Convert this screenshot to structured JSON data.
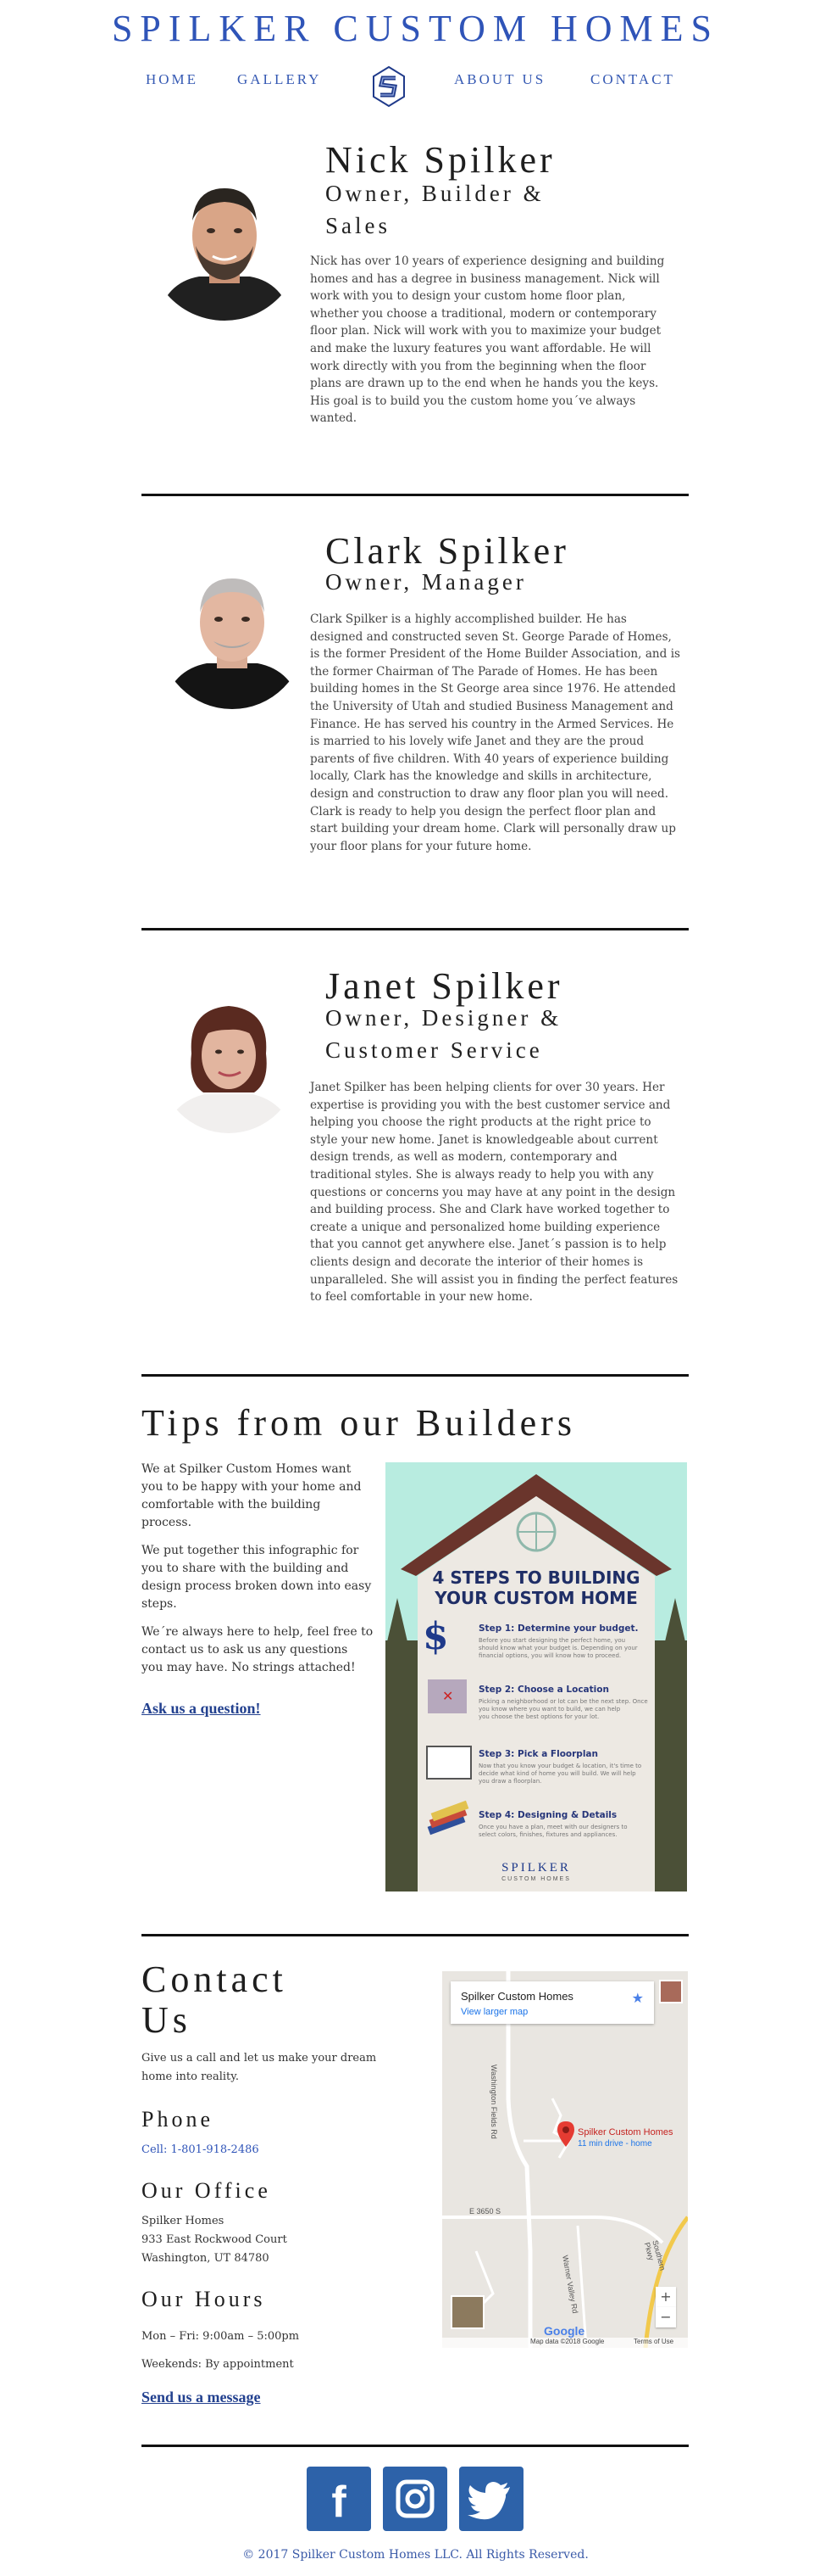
{
  "site": {
    "title": "SPILKER CUSTOM HOMES"
  },
  "nav": {
    "home": "HOME",
    "gallery": "GALLERY",
    "about": "ABOUT US",
    "contact": "CONTACT"
  },
  "team": [
    {
      "name": "Nick Spilker",
      "role_lines": [
        "Owner, Builder &",
        "Sales"
      ],
      "bio_lines": [
        "Nick has over 10 years of experience designing and building",
        "homes and has a degree in business management. Nick will",
        "work with you to design your custom home floor plan,",
        "whether you choose a traditional, modern or contemporary",
        "floor plan. Nick will work with you to maximize your budget",
        "and make the luxury features you want affordable. He will",
        "work directly with you from the beginning when the floor",
        "plans are drawn up to the end when he hands you the keys.",
        "His goal is to build you the custom home you´ve always",
        "wanted."
      ]
    },
    {
      "name": "Clark Spilker",
      "role_lines": [
        "Owner, Manager"
      ],
      "bio_lines": [
        "Clark Spilker is a highly accomplished builder. He has",
        "designed and constructed seven St. George Parade of Homes,",
        "is the former President of the Home Builder Association, and is",
        "the former Chairman of The Parade of Homes. He has been",
        "building homes in the St George area since 1976. He attended",
        "the University of Utah and studied Business Management and",
        "Finance. He has served his country in the Armed Services. He",
        "is married to his lovely wife Janet and they are the proud",
        "parents of five children. With 40 years of experience building",
        "locally, Clark has the knowledge and skills in architecture,",
        "design and construction to draw any floor plan you will need.",
        "Clark is ready to help you design the perfect floor plan and",
        "start building your dream home. Clark will personally draw up",
        "your floor plans for your future home."
      ]
    },
    {
      "name": "Janet Spilker",
      "role_lines": [
        "Owner, Designer &",
        "Customer Service"
      ],
      "bio_lines": [
        "Janet Spilker has been helping clients for over 30 years. Her",
        "expertise is providing you with the best customer service and",
        "helping you choose the right products at the right price to",
        "style your new home. Janet is knowledgeable about current",
        "design trends, as well as modern, contemporary and",
        "traditional styles. She is always ready to help you with any",
        "questions or concerns you may have at any point in the design",
        "and building process. She and Clark have worked together to",
        "create a unique and personalized home building experience",
        "that you cannot get anywhere else. Janet´s passion is to help",
        "clients design and decorate the interior of their homes is",
        "unparalleled. She will assist you in finding the perfect features",
        "to feel comfortable in your new home."
      ]
    }
  ],
  "tips": {
    "heading": "Tips from our Builders",
    "paragraphs": [
      [
        "We at Spilker Custom Homes want",
        "you to be happy with your home and",
        "comfortable with the building",
        "process."
      ],
      [
        "We put together this infographic for",
        "you to share with the building and",
        "design process broken down into easy",
        "steps."
      ],
      [
        "We´re always here to help, feel free to",
        "contact us to ask us any questions",
        "you may have. No strings attached!"
      ]
    ],
    "ask_link": "Ask us a question!",
    "infographic": {
      "title_line1": "4 STEPS TO BUILDING",
      "title_line2": "YOUR CUSTOM HOME",
      "steps": [
        {
          "title": "Step 1: Determine your budget.",
          "desc": [
            "Before you start designing the perfect home, you",
            "should know what your budget is. Depending on your",
            "financial options, you will know how to proceed."
          ]
        },
        {
          "title": "Step 2: Choose a Location",
          "desc": [
            "Picking a neighborhood or lot can be the next step. Once",
            "you know where you want to build, we can help",
            "you choose the best options for your lot."
          ]
        },
        {
          "title": "Step 3: Pick a Floorplan",
          "desc": [
            "Now that you know your budget & location, it's time to",
            "decide what kind of home you will build. We will help",
            "you draw a floorplan."
          ]
        },
        {
          "title": "Step 4: Designing & Details",
          "desc": [
            "Once you have a plan, meet with our designers to",
            "select colors, finishes, fixtures and appliances."
          ]
        }
      ],
      "brand": "SPILKER",
      "brand_sub": "CUSTOM HOMES"
    }
  },
  "contact": {
    "heading_line1": "Contact",
    "heading_line2": "Us",
    "intro_lines": [
      "Give us a call and let us make your dream",
      "home into reality."
    ],
    "phone_heading": "Phone",
    "phone": "Cell: 1-801-918-2486",
    "office_heading": "Our Office",
    "address_lines": [
      "Spilker Homes",
      "933 East Rockwood Court",
      "Washington, UT 84780"
    ],
    "hours_heading": "Our Hours",
    "hours_lines": [
      "Mon – Fri: 9:00am – 5:00pm",
      "Weekends: By appointment"
    ],
    "message_link": "Send us a message",
    "map": {
      "place_name": "Spilker Custom Homes",
      "larger_map": "View larger map",
      "pin_label": "Spilker Custom Homes",
      "pin_sub": "11 min drive - home",
      "road_1": "Washington Fields Rd",
      "road_2": "E 3650 S",
      "road_3": "Southern Pkwy",
      "road_4": "Warner Valley Rd",
      "zoom_in": "+",
      "zoom_out": "−",
      "google": "Google",
      "map_data": "Map data ©2018 Google",
      "terms": "Terms of Use"
    }
  },
  "footer": {
    "copyright": "© 2017 Spilker Custom Homes LLC. All Rights Reserved."
  },
  "colors": {
    "brand_blue": "#2f54b8",
    "link_blue": "#23418f",
    "social_blue": "#2d62a9"
  }
}
